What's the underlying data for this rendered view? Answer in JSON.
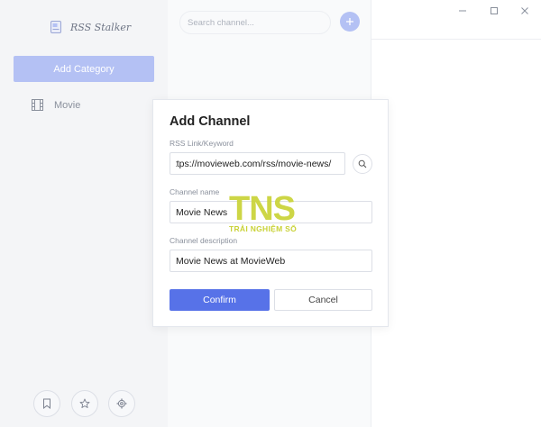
{
  "app": {
    "name": "RSS Stalker"
  },
  "sidebar": {
    "add_category_label": "Add Category",
    "categories": [
      {
        "label": "Movie",
        "icon": "film-icon"
      }
    ],
    "bottom_buttons": [
      {
        "icon": "bookmark-icon"
      },
      {
        "icon": "star-icon"
      },
      {
        "icon": "gear-icon"
      }
    ]
  },
  "channels": {
    "search_placeholder": "Search channel...",
    "add_icon": "plus-icon"
  },
  "window_controls": [
    "minimize-icon",
    "maximize-icon",
    "close-icon"
  ],
  "dialog": {
    "title": "Add Channel",
    "rss_label": "RSS Link/Keyword",
    "rss_value": "https://movieweb.com/rss/movie-news/",
    "name_label": "Channel name",
    "name_value": "Movie News",
    "description_label": "Channel description",
    "description_value": "Movie News at MovieWeb",
    "confirm_label": "Confirm",
    "cancel_label": "Cancel"
  },
  "watermark": {
    "logo_text": "TNS",
    "tagline": "TRẢI NGHIỆM SỐ"
  },
  "colors": {
    "accent": "#5772e8",
    "accent_light": "#b4c1f4",
    "sidebar_bg": "#f4f5f7",
    "watermark": "#c9d236"
  }
}
